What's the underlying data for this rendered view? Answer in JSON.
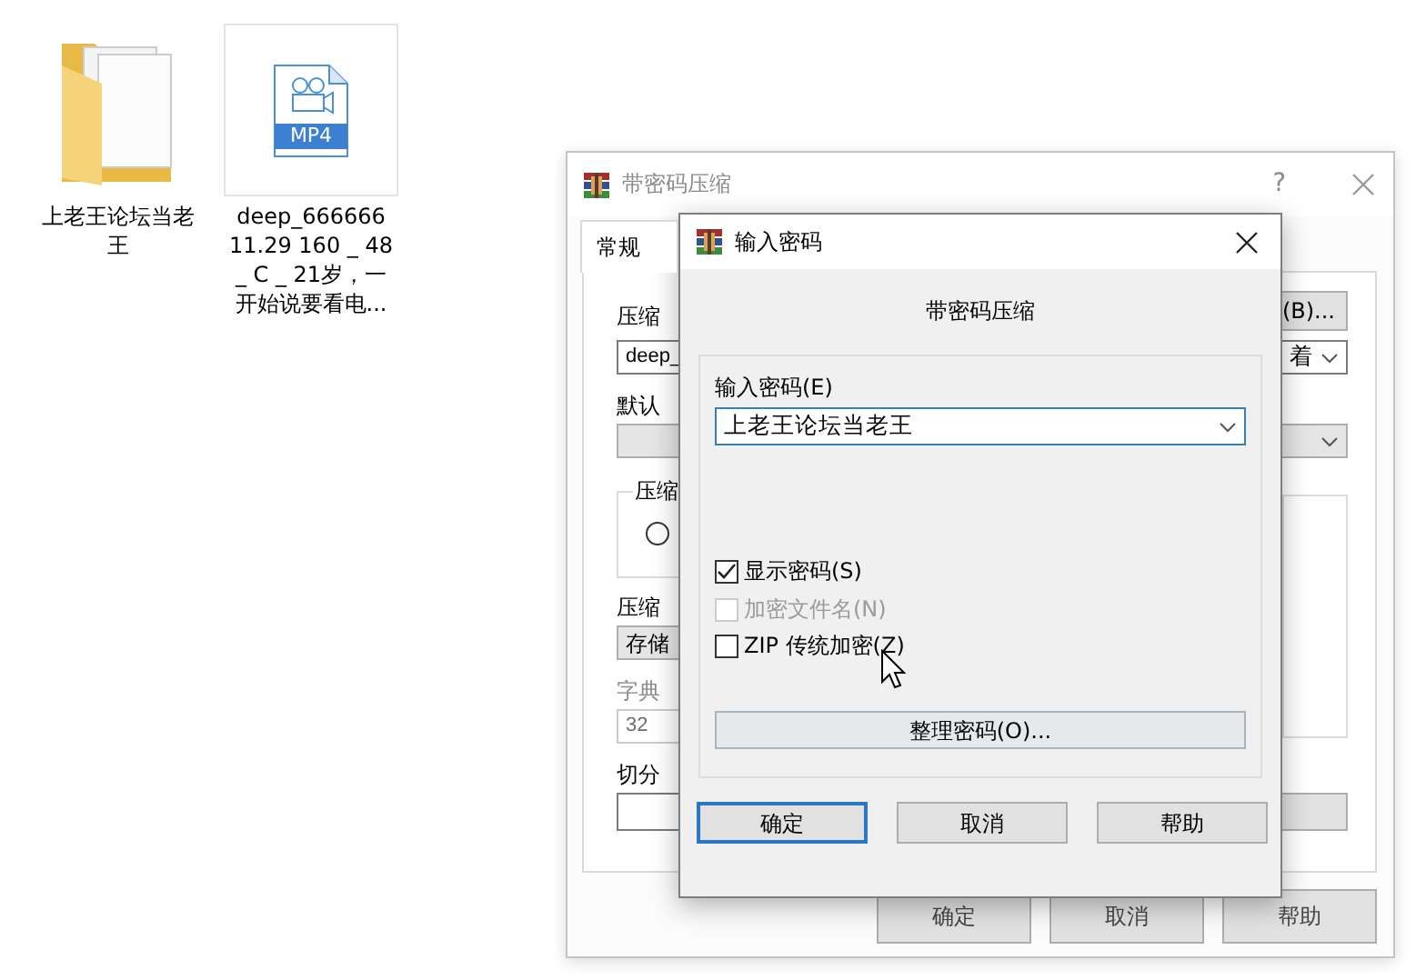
{
  "desktop_icons": [
    {
      "kind": "folder",
      "label_lines": [
        "上老王论坛当老",
        "王"
      ],
      "hovered": false
    },
    {
      "kind": "video",
      "badge": "MP4",
      "label_lines": [
        "deep_666666",
        "11.29 160 _ 48",
        "_ C _ 21岁，一",
        "开始说要看电..."
      ],
      "hovered": true
    }
  ],
  "back_window": {
    "title": "带密码压缩",
    "help": "?",
    "tabs": [
      {
        "label": "常规",
        "selected": true
      }
    ],
    "archive_name_label": "压缩",
    "browse_button": "(B)...",
    "archive_name_value": "deep_",
    "update_mode_value": "着",
    "profiles_label": "默认",
    "format_group": "压缩",
    "format_option": {
      "checked": false
    },
    "method_label": "压缩",
    "method_value": "存储",
    "dict_label": "字典",
    "dict_value": "32",
    "split_label": "切分",
    "buttons": [
      "确定",
      "取消",
      "帮助"
    ]
  },
  "dialog": {
    "title": "输入密码",
    "heading": "带密码压缩",
    "password_label": "输入密码(E)",
    "password_value": "上老王论坛当老王",
    "checkboxes": [
      {
        "label": "显示密码(S)",
        "checked": true,
        "disabled": false
      },
      {
        "label": "加密文件名(N)",
        "checked": false,
        "disabled": true
      },
      {
        "label": "ZIP 传统加密(Z)",
        "checked": false,
        "disabled": false
      }
    ],
    "organize_button": "整理密码(O)...",
    "buttons": [
      {
        "label": "确定",
        "default": true
      },
      {
        "label": "取消",
        "default": false
      },
      {
        "label": "帮助",
        "default": false
      }
    ]
  }
}
